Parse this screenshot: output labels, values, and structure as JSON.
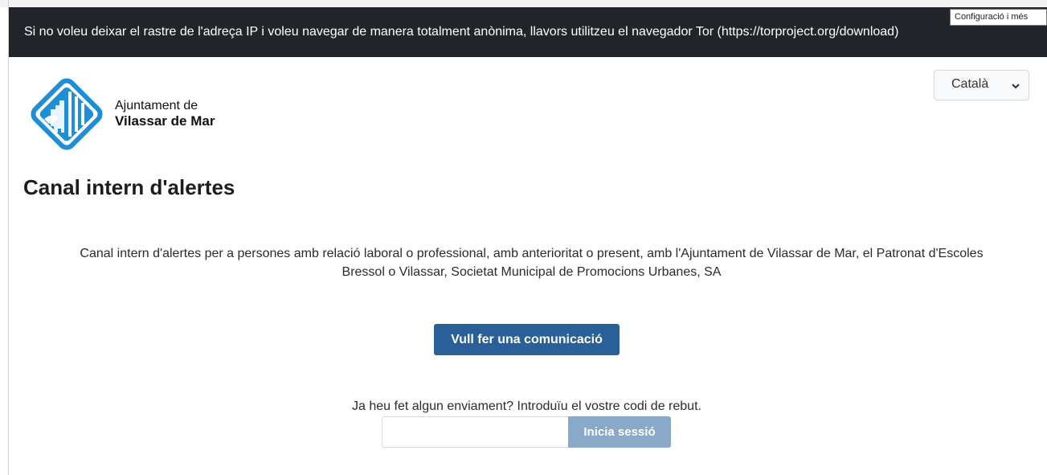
{
  "tor_notice": {
    "text": "Si no voleu deixar el rastre de l'adreça IP i voleu navegar de manera totalment anònima, llavors utilitzeu el navegador Tor (https://torproject.org/download)"
  },
  "tooltip": {
    "text": "Configuració i més"
  },
  "header": {
    "logo_line1": "Ajuntament de",
    "logo_line2": "Vilassar de Mar",
    "language_selected": "Català"
  },
  "main": {
    "title": "Canal intern d'alertes",
    "description_line1": "Canal intern d'alertes per a persones amb relació laboral o professional, amb anterioritat o present, amb l'Ajuntament de Vilassar de Mar, el Patronat d'Escoles",
    "description_line2": "Bressol o Vilassar, Societat Municipal de Promocions Urbanes, SA",
    "report_button": "Vull fer una comunicació",
    "receipt_prompt": "Ja heu fet algun enviament? Introduïu el vostre codi de rebut.",
    "receipt_input_value": "",
    "login_button": "Inicia sessió"
  },
  "colors": {
    "banner_bg": "#212529",
    "primary": "#2b5f98",
    "primary_disabled": "#8aa9c9",
    "logo_blue": "#1e8fd6"
  },
  "icons": {
    "logo": "municipal-coat-of-arms-icon",
    "select": "chevron-down-icon"
  }
}
